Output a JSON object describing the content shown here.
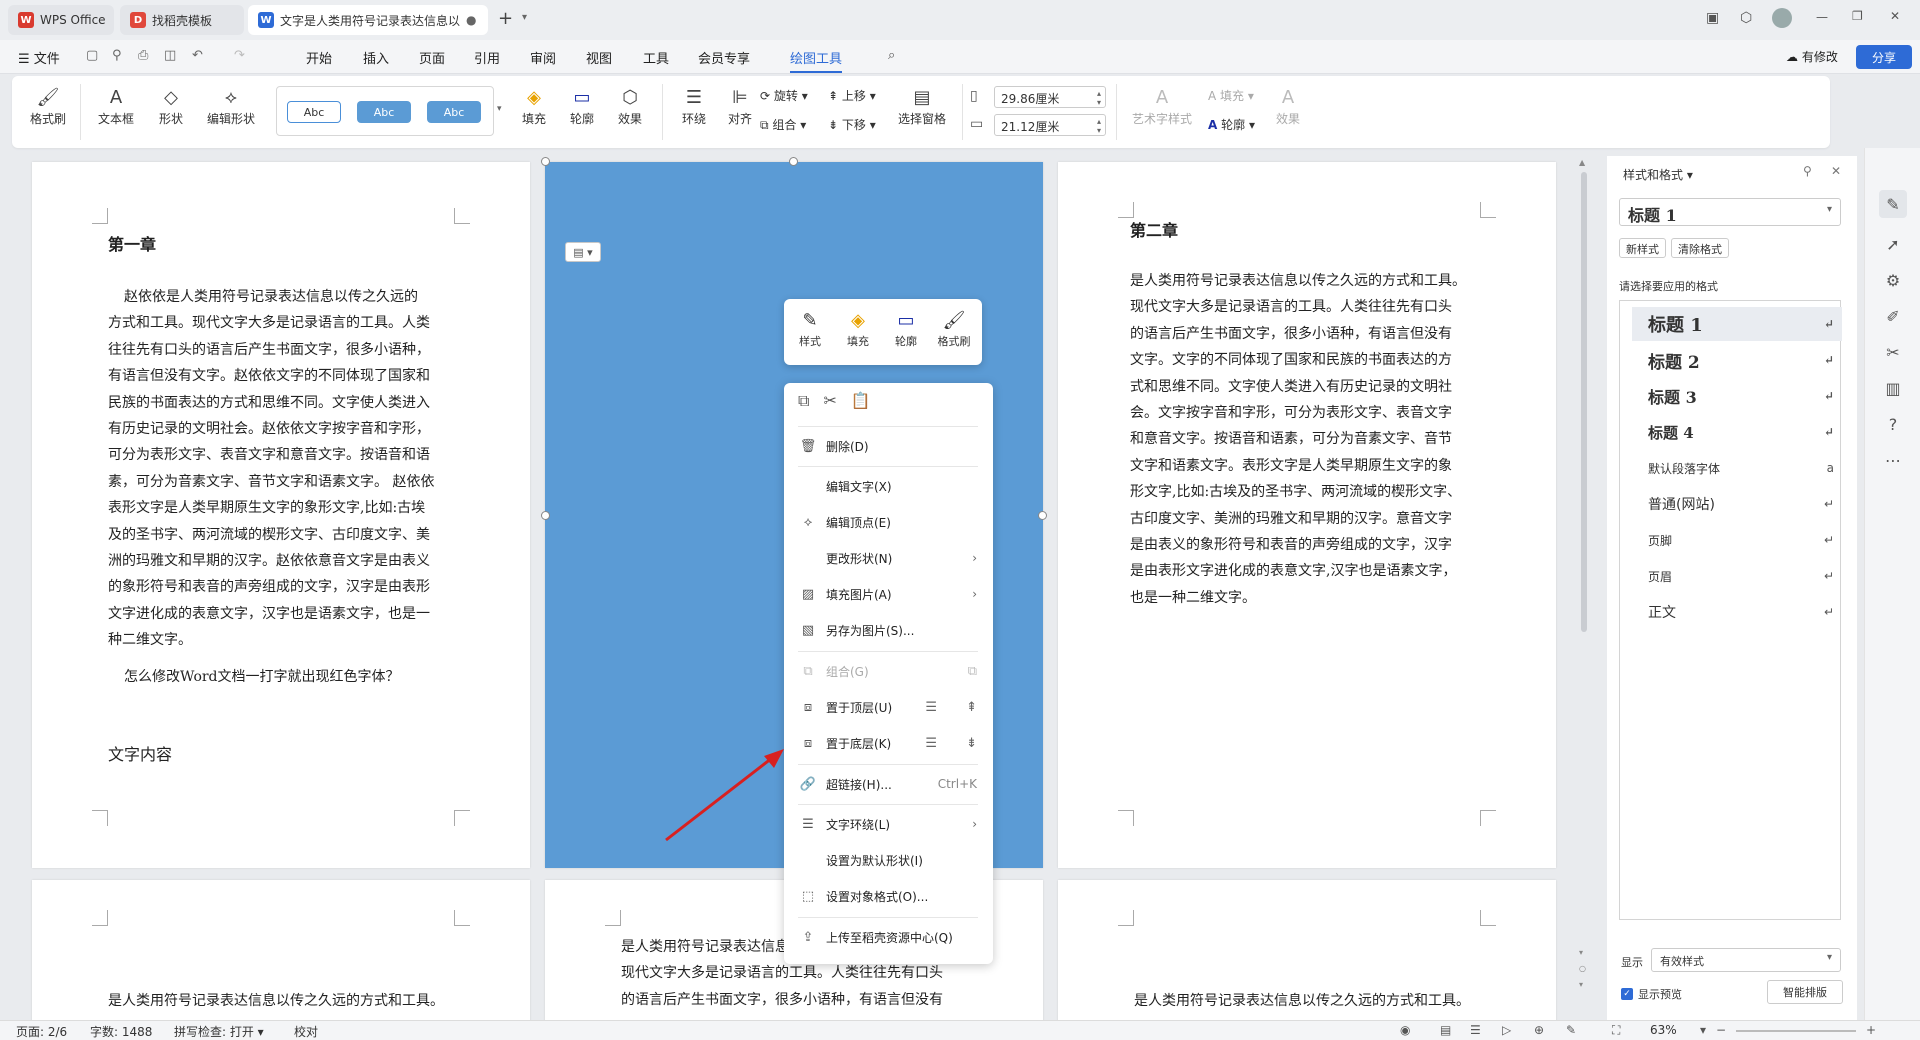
{
  "tabs": [
    {
      "label": "WPS Office",
      "color": "#d93a2f"
    },
    {
      "label": "找稻壳模板",
      "color": "#e0483b"
    },
    {
      "label": "文字是人类用符号记录表达信息以传之久远的方式和工具",
      "color": "#2e6bd6"
    }
  ],
  "window_controls": {
    "new_tab": "+",
    "min": "—",
    "max": "❐",
    "close": "✕"
  },
  "menu": {
    "file": "文件",
    "items": [
      "开始",
      "插入",
      "页面",
      "引用",
      "审阅",
      "视图",
      "工具",
      "会员专享",
      "绘图工具"
    ],
    "active": "绘图工具",
    "changes": "有修改",
    "share": "分享"
  },
  "ribbon": {
    "format_painter": "格式刷",
    "textbox": "文本框",
    "shape": "形状",
    "edit_shape": "编辑形状",
    "style_samples": [
      "Abc",
      "Abc",
      "Abc"
    ],
    "fill": "填充",
    "outline": "轮廓",
    "effect": "效果",
    "wrap": "环绕",
    "align": "对齐",
    "rotate": "旋转",
    "group": "组合",
    "bring_forward": "上移",
    "send_backward": "下移",
    "selection_pane": "选择窗格",
    "width": "29.86厘米",
    "height": "21.12厘米",
    "art_style": "艺术字样式",
    "text_fill": "填充",
    "text_outline": "轮廓",
    "text_effect": "效果"
  },
  "page1": {
    "title": "第一章",
    "lines": [
      "赵依依是人类用符号记录表达信息以传之久远的",
      "方式和工具。现代文字大多是记录语言的工具。人类",
      "往往先有口头的语言后产生书面文字，很多小语种，",
      "有语言但没有文字。赵依依文字的不同体现了国家和",
      "民族的书面表达的方式和思维不同。文字使人类进入",
      "有历史记录的文明社会。赵依依文字按字音和字形，",
      "可分为表形文字、表音文字和意音文字。按语音和语",
      "素，可分为音素文字、音节文字和语素文字。 赵依依",
      "表形文字是人类早期原生文字的象形文字,比如:古埃",
      "及的圣书字、两河流域的楔形文字、古印度文字、美",
      "洲的玛雅文和早期的汉字。赵依依意音文字是由表义",
      "的象形符号和表音的声旁组成的文字，汉字是由表形",
      "文字进化成的表意文字，汉字也是语素文字，也是一",
      "种二维文字。"
    ],
    "question": "怎么修改Word文档一打字就出现红色字体？",
    "subtitle": "文字内容"
  },
  "page3": {
    "title": "第二章",
    "lines": [
      "是人类用符号记录表达信息以传之久远的方式和工具。",
      "现代文字大多是记录语言的工具。人类往往先有口头",
      "的语言后产生书面文字，很多小语种，有语言但没有",
      "文字。文字的不同体现了国家和民族的书面表达的方",
      "式和思维不同。文字使人类进入有历史记录的文明社",
      "会。文字按字音和字形，可分为表形文字、表音文字",
      "和意音文字。按语音和语素，可分为音素文字、音节",
      "文字和语素文字。表形文字是人类早期原生文字的象",
      "形文字,比如:古埃及的圣书字、两河流域的楔形文字、",
      "古印度文字、美洲的玛雅文和早期的汉字。意音文字",
      "是由表义的象形符号和表音的声旁组成的文字，汉字",
      "是由表形文字进化成的表意文字,汉字也是语素文字，",
      "也是一种二维文字。"
    ]
  },
  "page5": {
    "lines": [
      "是人类用符号记录表达信息",
      "现代文字大多是记录语言的工具。人类往往先有口头",
      "的语言后产生书面文字，很多小语种，有语言但没有"
    ]
  },
  "page4": {
    "line": "是人类用符号记录表达信息以传之久远的方式和工具。"
  },
  "page6": {
    "line": "是人类用符号记录表达信息以传之久远的方式和工具。"
  },
  "mini_toolbar": {
    "style": "样式",
    "fill": "填充",
    "outline": "轮廓",
    "painter": "格式刷"
  },
  "context_menu": {
    "delete": "删除(D)",
    "edit_text": "编辑文字(X)",
    "edit_points": "编辑顶点(E)",
    "change_shape": "更改形状(N)",
    "fill_picture": "填充图片(A)",
    "save_as_picture": "另存为图片(S)...",
    "group": "组合(G)",
    "bring_to_front": "置于顶层(U)",
    "send_to_back": "置于底层(K)",
    "hyperlink": "超链接(H)...",
    "hyperlink_shortcut": "Ctrl+K",
    "text_wrap": "文字环绕(L)",
    "set_default": "设置为默认形状(I)",
    "format_object": "设置对象格式(O)...",
    "upload": "上传至稻壳资源中心(Q)"
  },
  "side": {
    "header": "样式和格式",
    "current": "标题 1",
    "new_style": "新样式",
    "clear_format": "清除格式",
    "prompt": "请选择要应用的格式",
    "styles": [
      "标题 1",
      "标题 2",
      "标题 3",
      "标题 4",
      "默认段落字体",
      "普通(网站)",
      "页脚",
      "页眉",
      "正文"
    ],
    "show_label": "显示",
    "show_value": "有效样式",
    "preview": "显示预览",
    "smart": "智能排版"
  },
  "status": {
    "page": "页面: 2/6",
    "words": "字数: 1488",
    "spell": "拼写检查: 打开",
    "proof": "校对",
    "zoom": "63%"
  }
}
